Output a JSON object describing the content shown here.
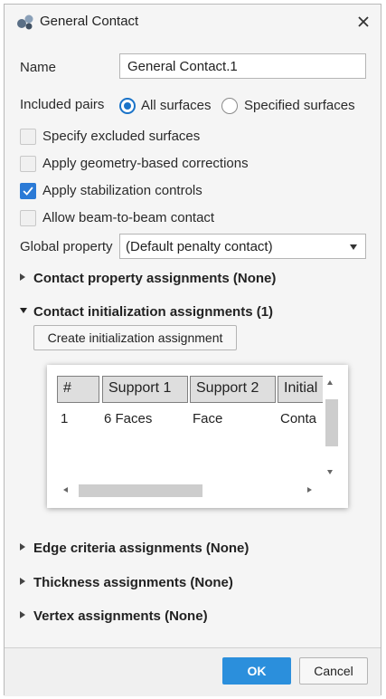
{
  "dialog": {
    "title": "General Contact",
    "close_icon": "close-icon"
  },
  "name": {
    "label": "Name",
    "value": "General Contact.1"
  },
  "included_pairs": {
    "label": "Included pairs",
    "options": [
      {
        "label": "All surfaces",
        "selected": true
      },
      {
        "label": "Specified surfaces",
        "selected": false
      }
    ]
  },
  "checkboxes": [
    {
      "label": "Specify excluded surfaces",
      "checked": false
    },
    {
      "label": "Apply geometry-based corrections",
      "checked": false
    },
    {
      "label": "Apply stabilization controls",
      "checked": true
    },
    {
      "label": "Allow beam-to-beam contact",
      "checked": false
    }
  ],
  "global_property": {
    "label": "Global property",
    "value": "(Default penalty contact)"
  },
  "sections": {
    "contact_property": "Contact property assignments (None)",
    "contact_init": "Contact initialization assignments (1)",
    "edge_criteria": "Edge criteria assignments (None)",
    "thickness": "Thickness assignments (None)",
    "vertex": "Vertex assignments (None)"
  },
  "create_init_button": "Create initialization assignment",
  "table": {
    "headers": [
      "#",
      "Support 1",
      "Support 2",
      "Initial"
    ],
    "rows": [
      [
        "1",
        "6 Faces",
        "Face",
        "Conta"
      ]
    ]
  },
  "buttons": {
    "ok": "OK",
    "cancel": "Cancel"
  },
  "colors": {
    "accent": "#2b7ad6",
    "ok_button": "#2b8fdc"
  }
}
